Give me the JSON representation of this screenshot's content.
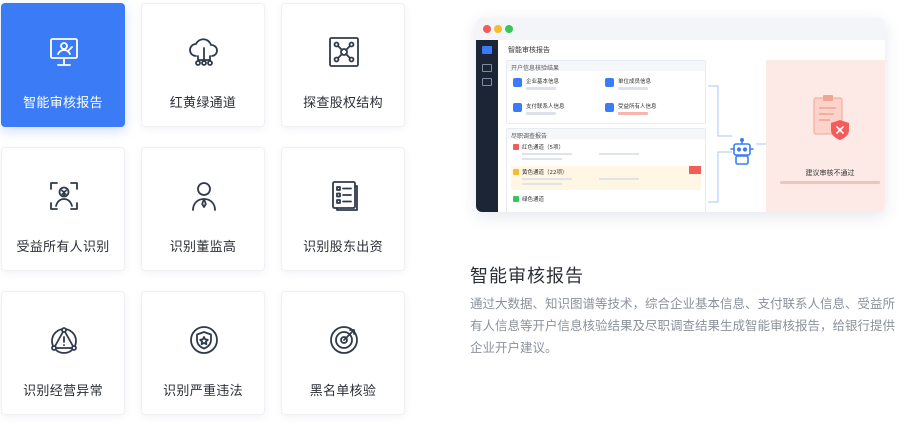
{
  "cards": [
    {
      "label": "智能审核报告",
      "icon": "report-monitor-icon",
      "active": true
    },
    {
      "label": "红黄绿通道",
      "icon": "cloud-network-icon",
      "active": false
    },
    {
      "label": "探查股权结构",
      "icon": "equity-structure-icon",
      "active": false
    },
    {
      "label": "受益所有人识别",
      "icon": "beneficial-owner-icon",
      "active": false
    },
    {
      "label": "识别董监高",
      "icon": "executive-person-icon",
      "active": false
    },
    {
      "label": "识别股东出资",
      "icon": "shareholder-list-icon",
      "active": false
    },
    {
      "label": "识别经营异常",
      "icon": "warning-triangle-icon",
      "active": false
    },
    {
      "label": "识别严重违法",
      "icon": "shield-badge-icon",
      "active": false
    },
    {
      "label": "黑名单核验",
      "icon": "target-radar-icon",
      "active": false
    }
  ],
  "preview": {
    "window_title": "智能审核报告",
    "section1_title": "开户信息核验结果",
    "mini_cards": [
      "企业基本信息",
      "单位成员信息",
      "支付联系人信息",
      "受益所有人信息"
    ],
    "section2_title": "尽职调查报告",
    "rows": [
      "红色通道（5项）",
      "黄色通道（22项）",
      "绿色通道"
    ],
    "result_label": "建议审核不通过"
  },
  "detail": {
    "title": "智能审核报告",
    "description": "通过大数据、知识图谱等技术，综合企业基本信息、支付联系人信息、受益所有人信息等开户信息核验结果及尽职调查结果生成智能审核报告，给银行提供企业开户建议。"
  },
  "colors": {
    "accent": "#3b7cf6",
    "icon": "#2f3a4a",
    "red": "#f45b5b",
    "yellow": "#f7bb2e",
    "green": "#35c759"
  }
}
